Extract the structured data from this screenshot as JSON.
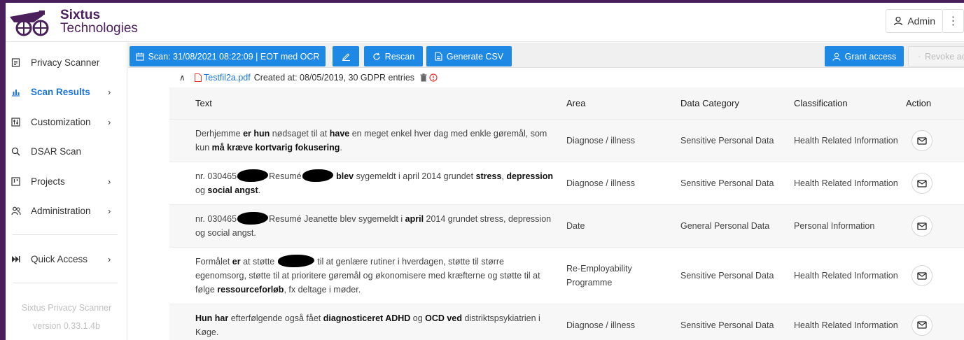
{
  "brand": {
    "line1": "Sixtus",
    "line2": "Technologies",
    "color": "#4a1f5c"
  },
  "header": {
    "admin_label": "Admin",
    "menu_icon": "kebab-icon"
  },
  "sidebar": {
    "items": [
      {
        "label": "Privacy Scanner",
        "icon": "scanner-icon",
        "chevron": ""
      },
      {
        "label": "Scan Results",
        "icon": "chart-icon",
        "chevron": "›"
      },
      {
        "label": "Customization",
        "icon": "sliders-icon",
        "chevron": "›"
      },
      {
        "label": "DSAR Scan",
        "icon": "search-icon",
        "chevron": ""
      },
      {
        "label": "Projects",
        "icon": "projects-icon",
        "chevron": "›"
      },
      {
        "label": "Administration",
        "icon": "users-icon",
        "chevron": "›"
      },
      {
        "label": "Quick Access",
        "icon": "fast-forward-icon",
        "chevron": "›"
      }
    ],
    "footer_line1": "Sixtus Privacy Scanner",
    "footer_line2": "version 0.33.1.4b",
    "accent_color": "#1a73d9"
  },
  "toolbar": {
    "scan_label": "Scan: 31/08/2021 08:22:09 | EOT med OCR",
    "rescan_label": "Rescan",
    "csv_label": "Generate CSV",
    "grant_label": "Grant access",
    "revoke_label": "Revoke ac",
    "button_color": "#1e88e5"
  },
  "file": {
    "name": "Testfil2a.pdf",
    "meta": "Created at: 08/05/2019, 30 GDPR entries"
  },
  "table": {
    "headers": {
      "text": "Text",
      "area": "Area",
      "category": "Data Category",
      "classification": "Classification",
      "action": "Action"
    },
    "rows": [
      {
        "area": "Diagnose / illness",
        "category": "Sensitive Personal Data",
        "classification": "Health Related Information"
      },
      {
        "area": "Diagnose / illness",
        "category": "Sensitive Personal Data",
        "classification": "Health Related Information"
      },
      {
        "area": "Date",
        "category": "General Personal Data",
        "classification": "Personal Information"
      },
      {
        "area": "Re-Employability Programme",
        "category": "Sensitive Personal Data",
        "classification": "Health Related Information"
      },
      {
        "area": "Diagnose / illness",
        "category": "Sensitive Personal Data",
        "classification": "Health Related Information"
      }
    ],
    "texts": {
      "r0": {
        "a": "Derhjemme ",
        "b": "er hun",
        "c": " nødsaget til at ",
        "d": "have",
        "e": " en meget enkel hver dag med enkle gøremål, som kun ",
        "f": "må kræve kortvarig fokusering",
        "g": "."
      },
      "r1": {
        "a": "nr. 030465",
        "b": "Resumé",
        "c": "blev",
        "d": " sygemeldt i april 2014 grundet ",
        "e": "stress",
        "f": ", ",
        "g": "depression",
        "h": " og ",
        "i": "social angst",
        "j": "."
      },
      "r2": {
        "a": "nr. 030465",
        "b": "Resumé Jeanette blev sygemeldt i ",
        "c": "april",
        "d": " 2014 grundet stress, depression og social angst."
      },
      "r3": {
        "a": "Formålet ",
        "b": "er",
        "c": " at støtte ",
        "d": "til at genlære rutiner i hverdagen, støtte til større egenomsorg, støtte til at prioritere gøremål og økonomisere med kræfterne og støtte til at følge ",
        "e": "ressourceforløb",
        "f": ", fx deltage i møder."
      },
      "r4": {
        "a": "Hun har",
        "b": " efterfølgende også fået ",
        "c": "diagnosticeret ADHD",
        "d": " og ",
        "e": "OCD ved",
        "f": " distriktspsykiatrien i Køge."
      }
    }
  }
}
